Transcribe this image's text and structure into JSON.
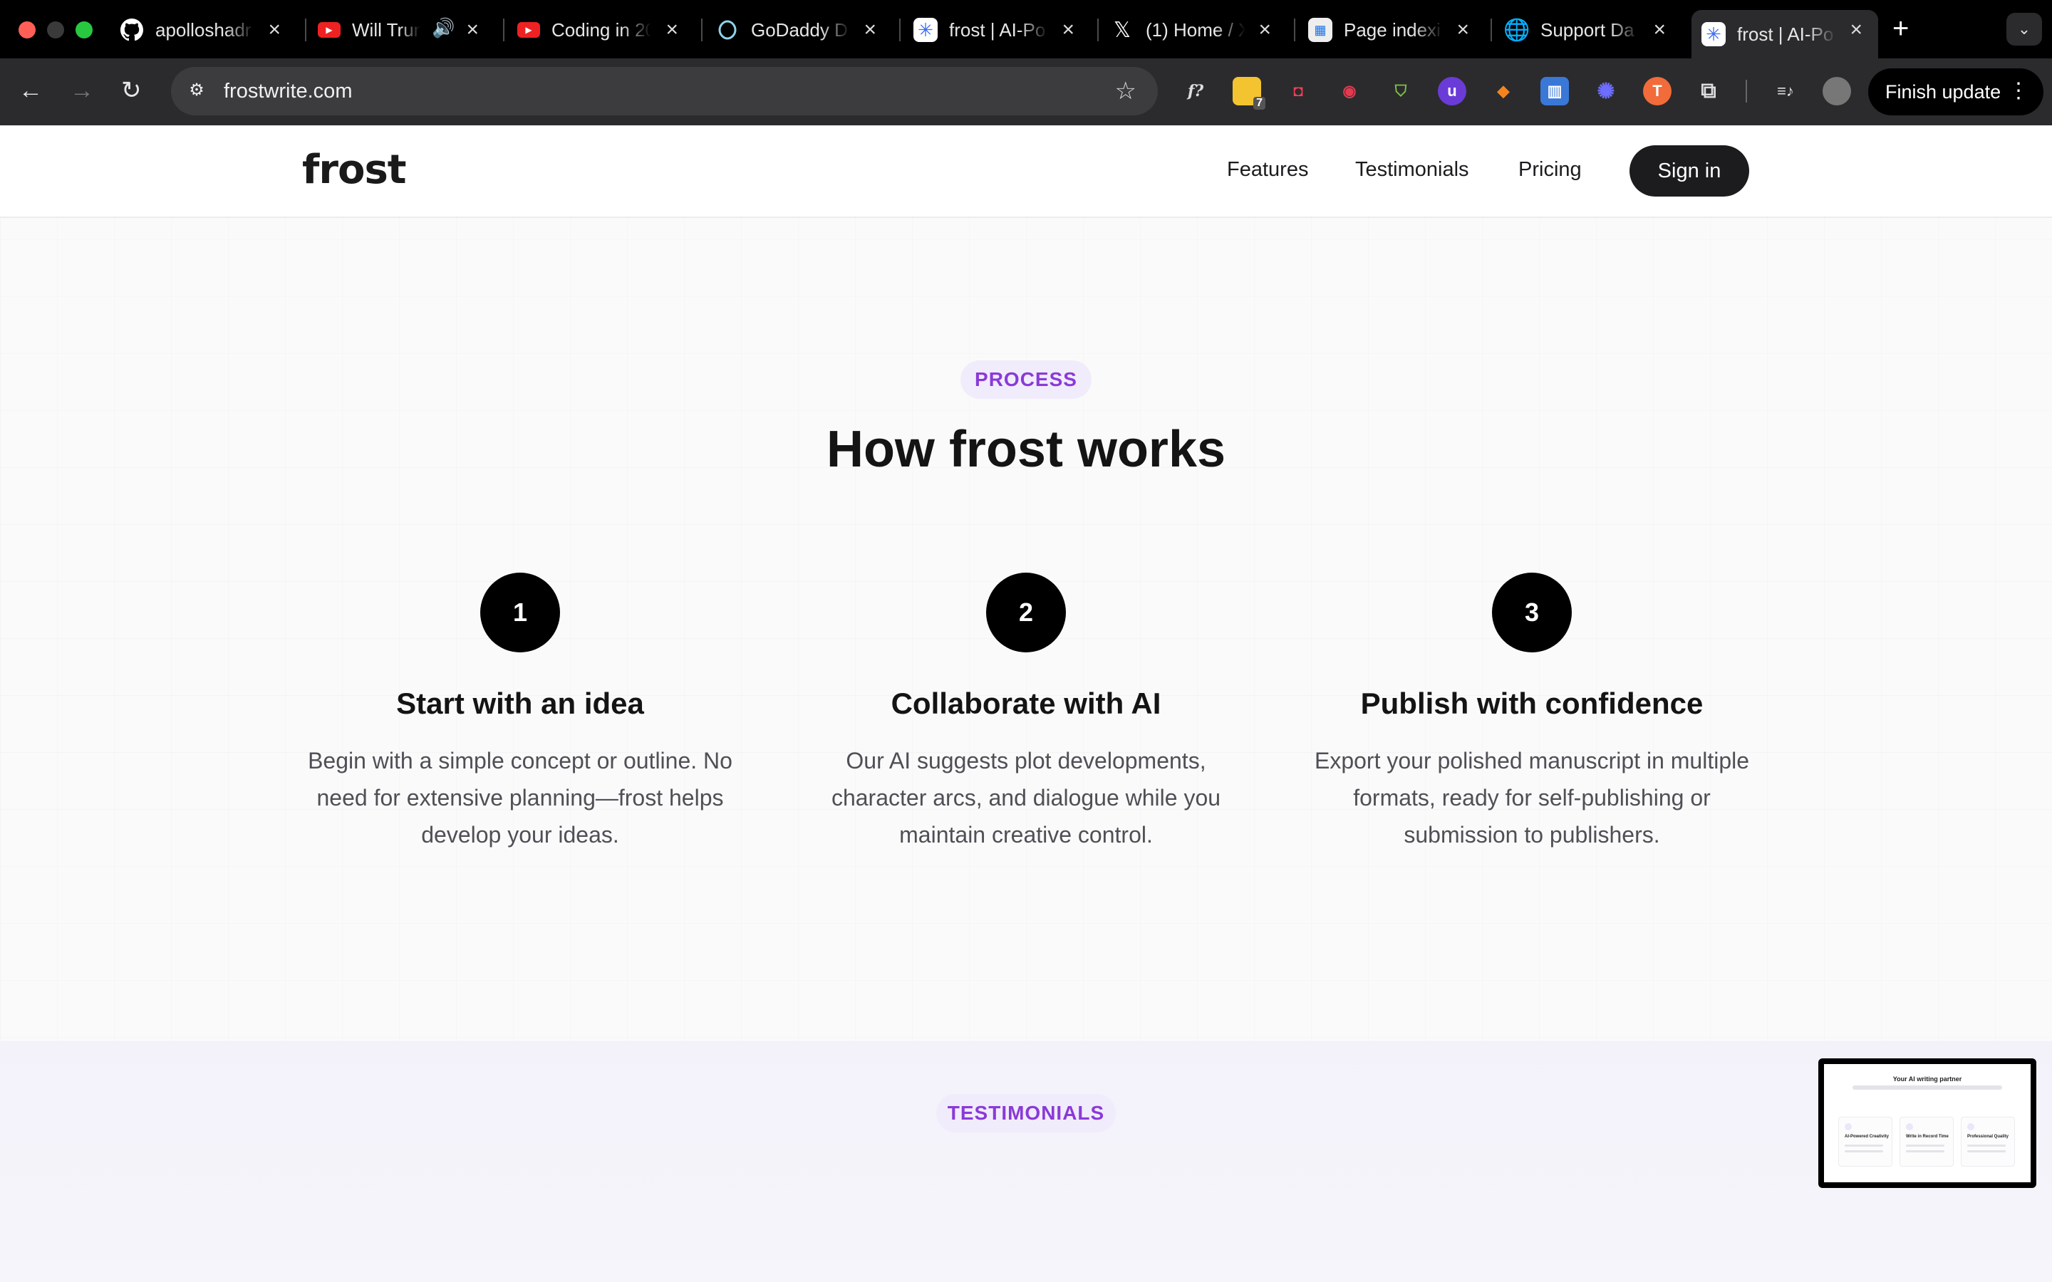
{
  "browser": {
    "tabs": [
      {
        "title": "apolloshadr",
        "icon": "github-icon",
        "active": false
      },
      {
        "title": "Will Trun",
        "icon": "youtube-icon",
        "audio": true,
        "active": false
      },
      {
        "title": "Coding in 20",
        "icon": "youtube-icon",
        "active": false
      },
      {
        "title": "GoDaddy D",
        "icon": "godaddy-icon",
        "active": false
      },
      {
        "title": "frost | AI-Po",
        "icon": "frost-icon",
        "active": false
      },
      {
        "title": "(1) Home / X",
        "icon": "x-icon",
        "active": false
      },
      {
        "title": "Page indexi",
        "icon": "search-console-icon",
        "active": false
      },
      {
        "title": "Support Da",
        "icon": "globe-icon",
        "active": false
      },
      {
        "title": "frost | AI-Po",
        "icon": "frost-icon",
        "active": true
      }
    ],
    "url": "frostwrite.com",
    "finish_update": "Finish update",
    "extension_badge": "7"
  },
  "site": {
    "logo": "frost",
    "nav": [
      "Features",
      "Testimonials",
      "Pricing"
    ],
    "signin": "Sign in"
  },
  "process": {
    "badge": "PROCESS",
    "title": "How frost works",
    "steps": [
      {
        "num": "1",
        "title": "Start with an idea",
        "desc": "Begin with a simple concept or outline. No need for extensive planning—frost helps develop your ideas."
      },
      {
        "num": "2",
        "title": "Collaborate with AI",
        "desc": "Our AI suggests plot developments, character arcs, and dialogue while you maintain creative control."
      },
      {
        "num": "3",
        "title": "Publish with confidence",
        "desc": "Export your polished manuscript in multiple formats, ready for self-publishing or submission to publishers."
      }
    ]
  },
  "testimonials": {
    "badge": "TESTIMONIALS"
  },
  "pip": {
    "title": "Your AI writing partner",
    "cards": [
      "AI-Powered Creativity",
      "Write in Record Time",
      "Professional Quality"
    ]
  },
  "colors": {
    "accent": "#8a3ad8",
    "badge_bg": "#f1ecfb",
    "dark": "#1c1c1e"
  }
}
